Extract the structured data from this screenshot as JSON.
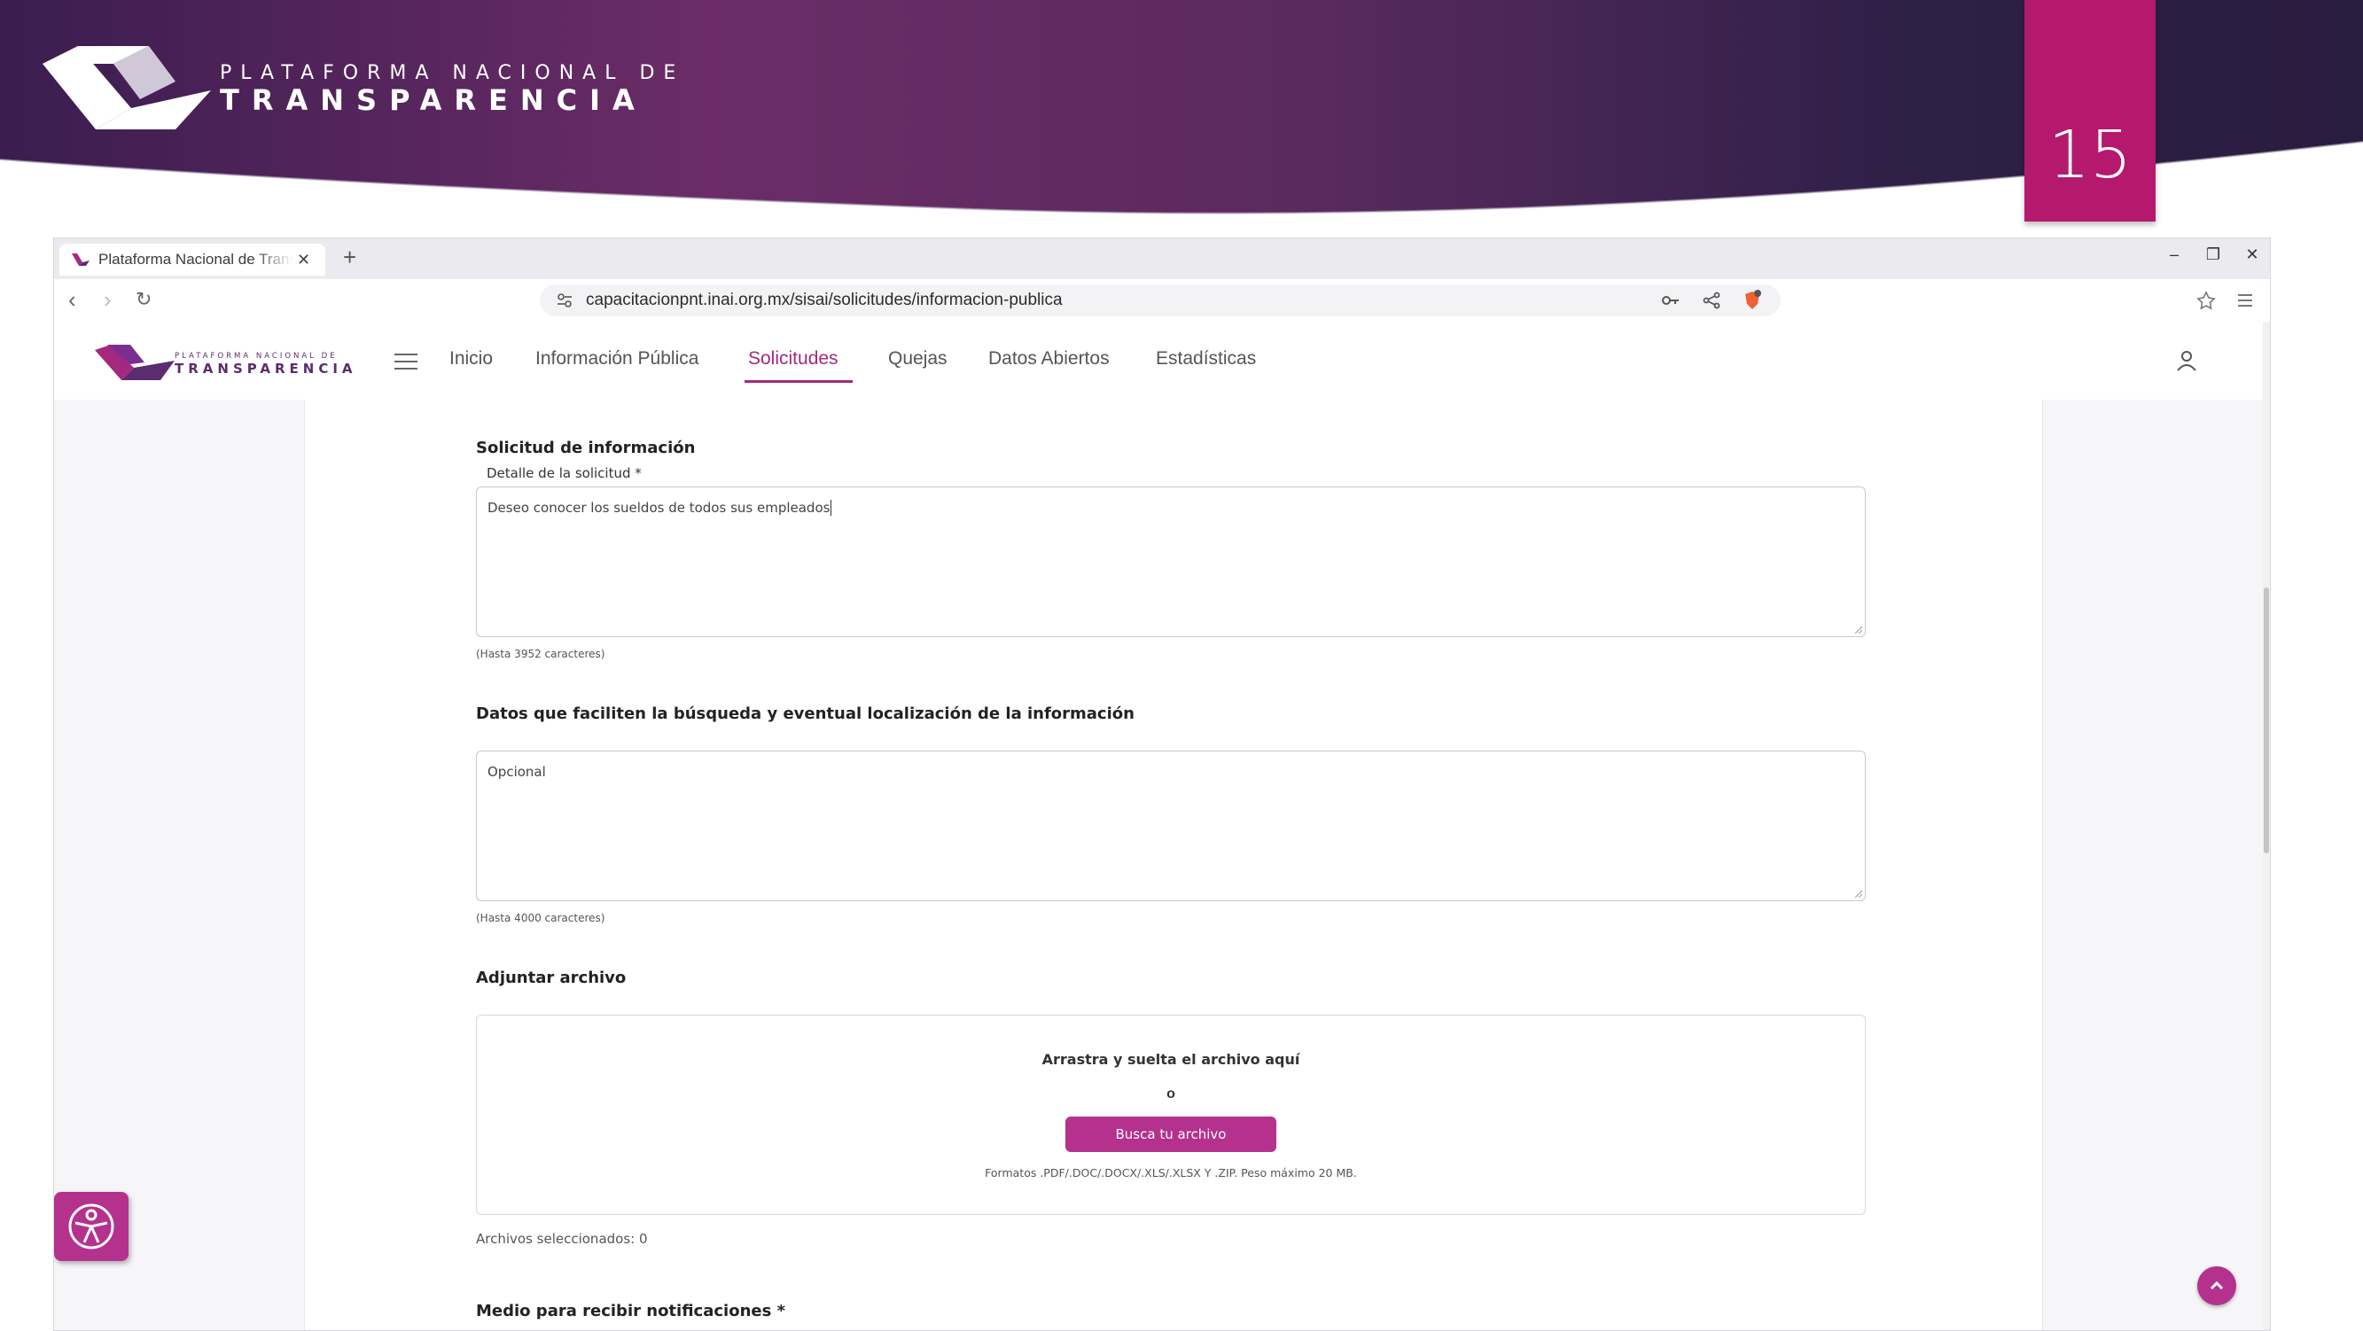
{
  "slide": {
    "brand_line1": "PLATAFORMA NACIONAL DE",
    "brand_line2": "TRANSPARENCIA",
    "page_number": "15"
  },
  "browser": {
    "tab_title": "Plataforma Nacional de Transparencia",
    "url": "capacitacionpnt.inai.org.mx/sisai/solicitudes/informacion-publica"
  },
  "site": {
    "brand_line1": "PLATAFORMA NACIONAL DE",
    "brand_line2": "TRANSPARENCIA",
    "menu": [
      "Inicio",
      "Información Pública",
      "Solicitudes",
      "Quejas",
      "Datos Abiertos",
      "Estadísticas"
    ],
    "active_menu": "Solicitudes"
  },
  "form": {
    "section_request": "Solicitud de información",
    "detail_label": "Detalle de la solicitud *",
    "detail_value": "Deseo conocer los sueldos de todos sus empleados",
    "detail_hint": "(Hasta 3952 caracteres)",
    "search_data_label": "Datos que faciliten la búsqueda y eventual localización de la información",
    "search_data_placeholder": "Opcional",
    "search_data_hint": "(Hasta 4000 caracteres)",
    "attach_label": "Adjuntar archivo",
    "dropzone_title": "Arrastra y suelta el archivo aquí",
    "dropzone_or": "o",
    "browse_button": "Busca tu archivo",
    "formats": "Formatos .PDF/.DOC/.DOCX/.XLS/.XLSX Y .ZIP. Peso máximo 20 MB.",
    "selected_files": "Archivos seleccionados: 0",
    "notify_label": "Medio para recibir notificaciones *"
  },
  "colors": {
    "accent": "#b5318e",
    "banner_start": "#3a1c4a",
    "banner_end": "#2a1a3e",
    "slide_number_bg": "#b5196e"
  }
}
